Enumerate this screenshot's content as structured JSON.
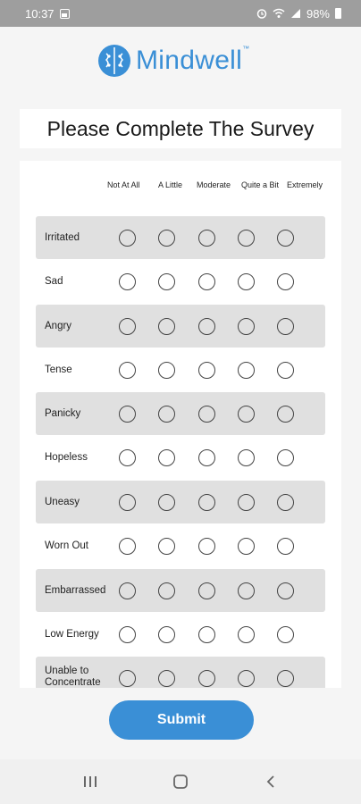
{
  "status_bar": {
    "time": "10:37",
    "battery": "98%"
  },
  "logo": {
    "name": "Mindwell",
    "tm": "™"
  },
  "title": "Please Complete The Survey",
  "columns": [
    "Not At All",
    "A Little",
    "Moderate",
    "Quite a Bit",
    "Extremely"
  ],
  "rows": [
    {
      "label": "Irritated"
    },
    {
      "label": "Sad"
    },
    {
      "label": "Angry"
    },
    {
      "label": "Tense"
    },
    {
      "label": "Panicky"
    },
    {
      "label": "Hopeless"
    },
    {
      "label": "Uneasy"
    },
    {
      "label": "Worn Out"
    },
    {
      "label": "Embarrassed"
    },
    {
      "label": "Low Energy"
    },
    {
      "label": "Unable to Concentrate"
    }
  ],
  "submit_label": "Submit",
  "colors": {
    "accent": "#3a8fd6",
    "row_shade": "#e0e0e0",
    "status_bar": "#9e9e9e"
  }
}
